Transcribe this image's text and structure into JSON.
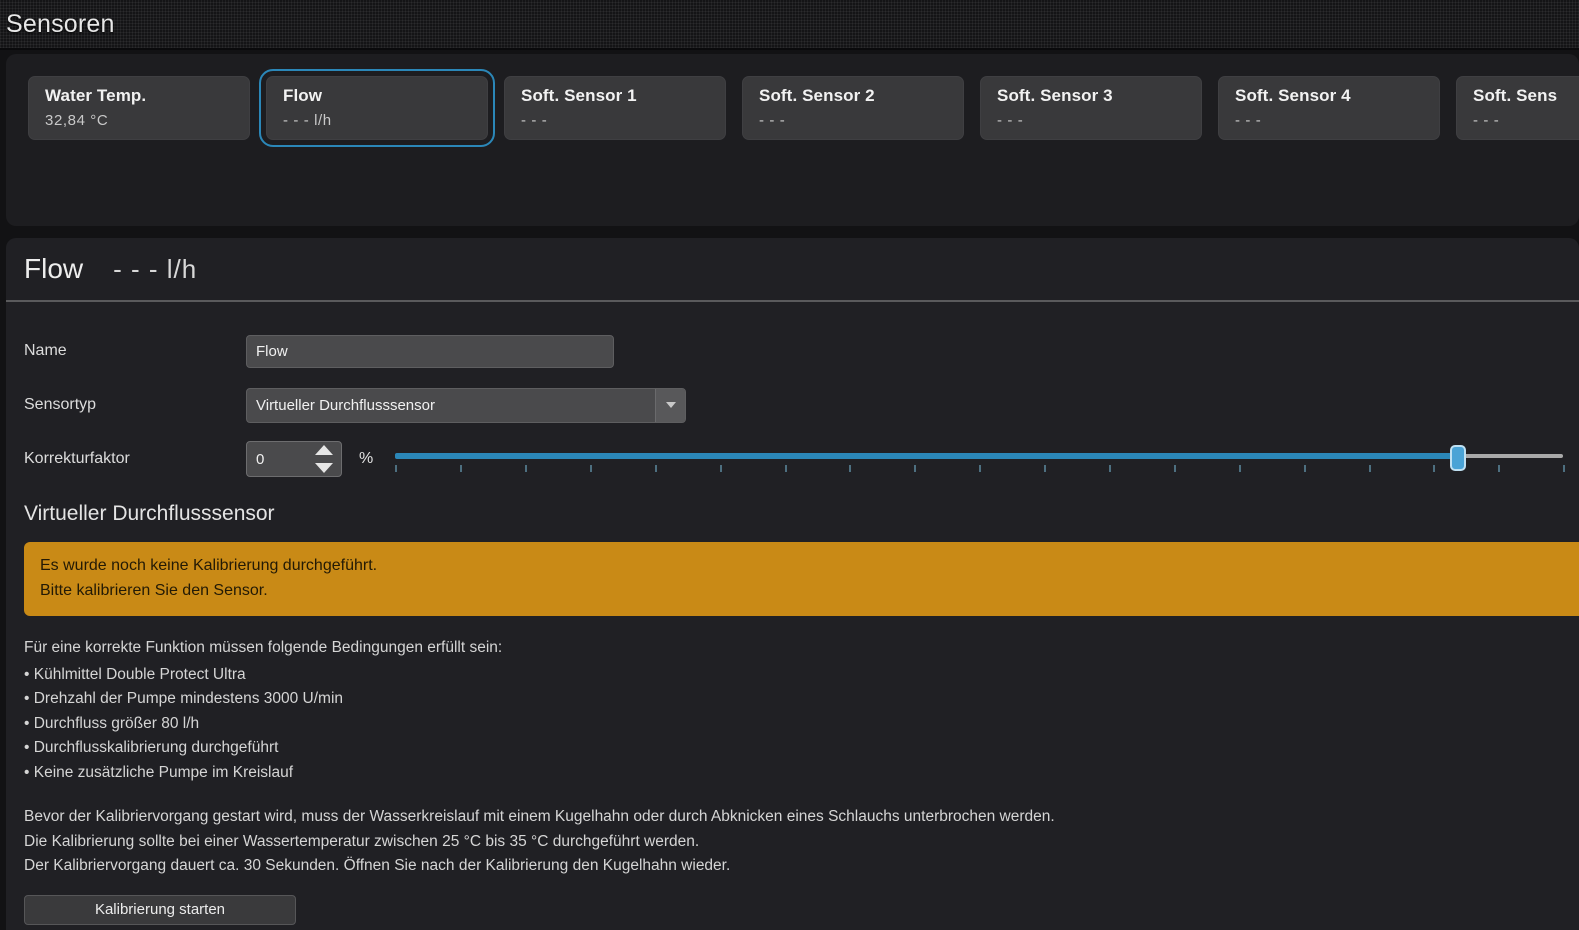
{
  "titlebar": {
    "title": "Sensoren"
  },
  "tabs": [
    {
      "name": "Water Temp.",
      "value": "32,84 °C",
      "selected": false
    },
    {
      "name": "Flow",
      "value": "- - - l/h",
      "selected": true
    },
    {
      "name": "Soft. Sensor 1",
      "value": "- - -",
      "selected": false
    },
    {
      "name": "Soft. Sensor 2",
      "value": "- - -",
      "selected": false
    },
    {
      "name": "Soft. Sensor 3",
      "value": "- - -",
      "selected": false
    },
    {
      "name": "Soft. Sensor 4",
      "value": "- - -",
      "selected": false
    },
    {
      "name": "Soft. Sens",
      "value": "- - -",
      "selected": false
    }
  ],
  "detail": {
    "title": "Flow",
    "value": "- - - l/h",
    "fields": {
      "name_label": "Name",
      "name_value": "Flow",
      "sensortyp_label": "Sensortyp",
      "sensortyp_value": "Virtueller Durchflusssensor",
      "korrektur_label": "Korrekturfaktor",
      "korrektur_value": "0",
      "korrektur_unit": "%"
    },
    "slider": {
      "fill_percent": 91
    },
    "section_title": "Virtueller Durchflusssensor",
    "banner": {
      "line1": "Es wurde noch keine Kalibrierung durchgeführt.",
      "line2": "Bitte kalibrieren Sie den Sensor.",
      "color": "#c98a16"
    },
    "conditions_intro": "Für eine korrekte Funktion müssen folgende Bedingungen erfüllt sein:",
    "conditions": [
      "Kühlmittel Double Protect Ultra",
      "Drehzahl der Pumpe mindestens 3000 U/min",
      "Durchfluss größer 80 l/h",
      "Durchflusskalibrierung durchgeführt",
      "Keine zusätzliche Pumpe im Kreislauf"
    ],
    "paragraph": [
      "Bevor der Kalibriervorgang gestart wird, muss der Wasserkreislauf mit einem Kugelhahn oder durch Abknicken eines Schlauchs unterbrochen werden.",
      "Die Kalibrierung sollte bei einer Wassertemperatur zwischen 25 °C bis 35 °C durchgeführt werden.",
      "Der Kalibriervorgang dauert ca. 30 Sekunden. Öffnen Sie nach der Kalibrierung den Kugelhahn wieder."
    ],
    "calibrate_button": "Kalibrierung starten"
  },
  "accent_color": "#2b87b8"
}
